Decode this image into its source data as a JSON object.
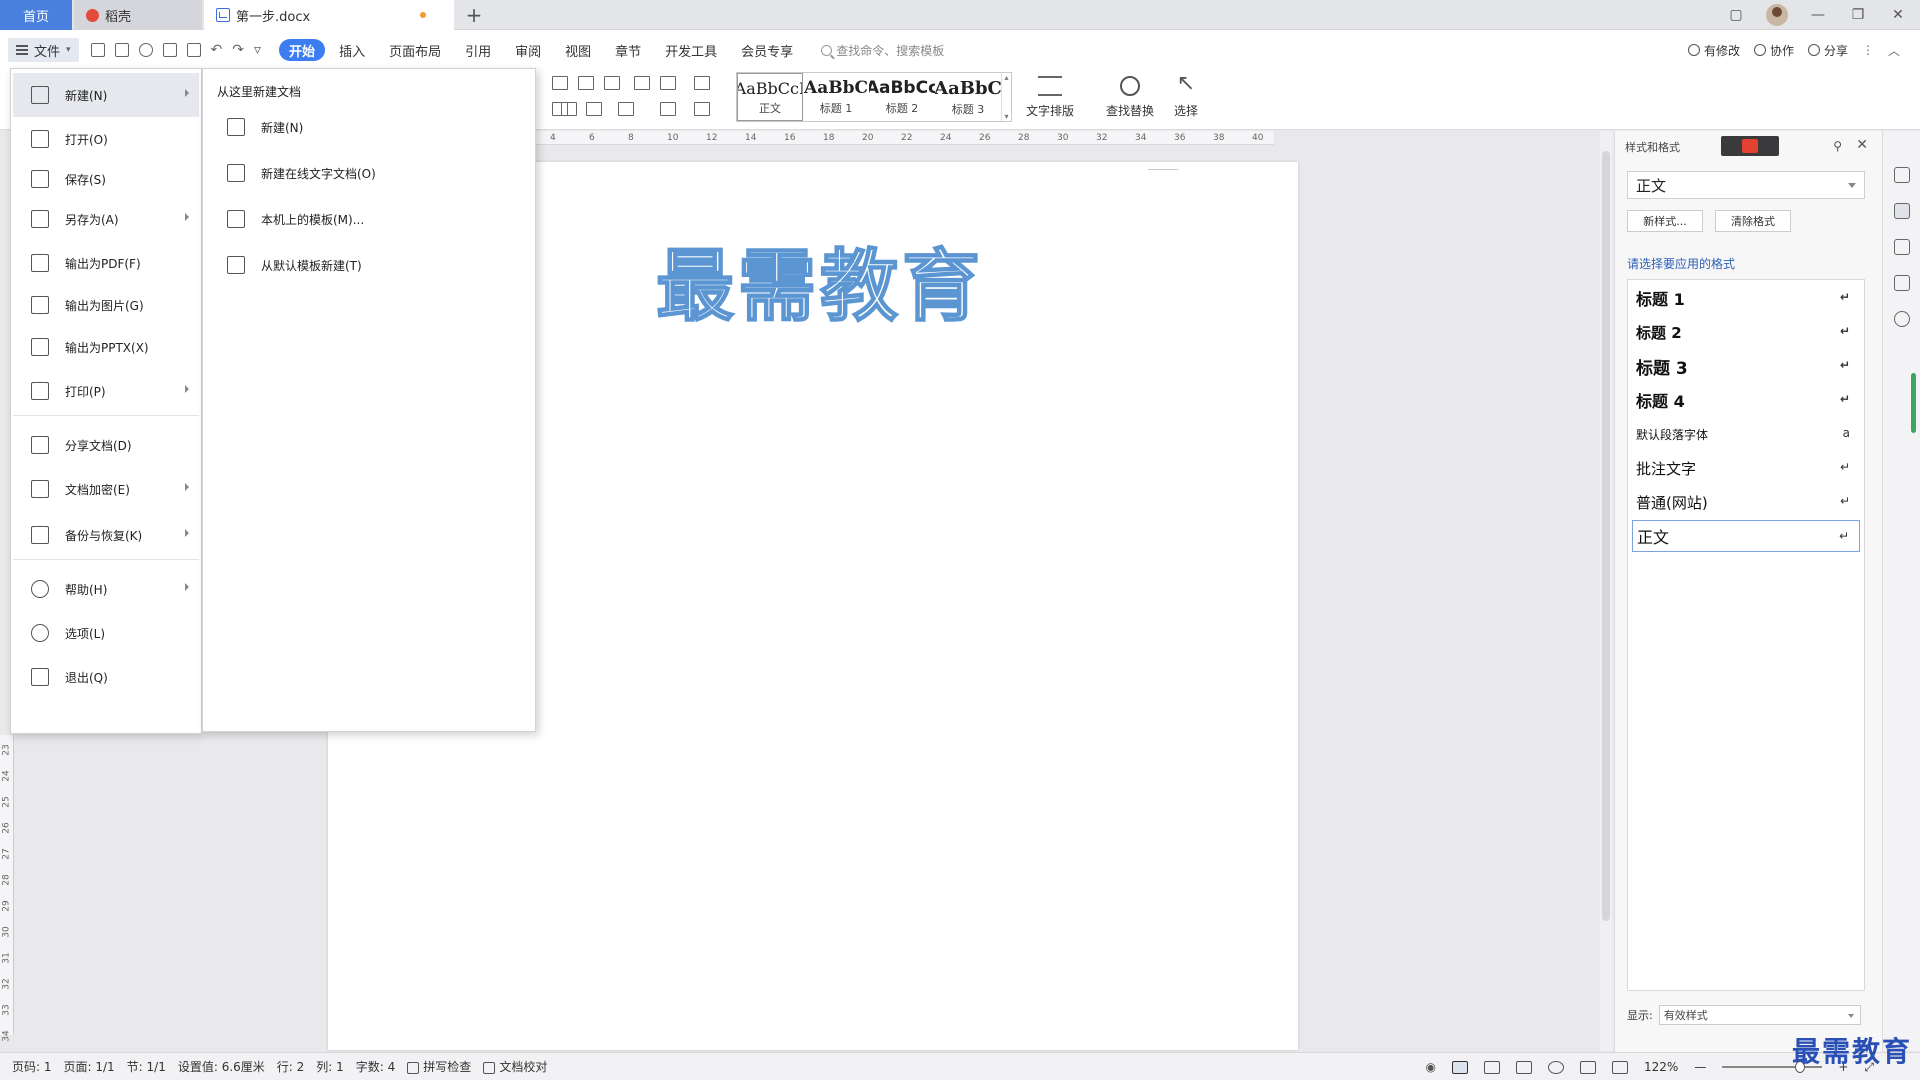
{
  "tabs": {
    "home": "首页",
    "daoke": "稻壳",
    "document": "第一步.docx",
    "new_tab": "+"
  },
  "menu": {
    "file": "文件",
    "tabs": [
      "开始",
      "插入",
      "页面布局",
      "引用",
      "审阅",
      "视图",
      "章节",
      "开发工具",
      "会员专享"
    ],
    "active_tab": "开始",
    "search_placeholder": "查找命令、搜索模板",
    "right": [
      "有修改",
      "协作",
      "分享"
    ]
  },
  "ribbon": {
    "styles": [
      {
        "sample": "AaBbCcI",
        "label": "正文"
      },
      {
        "sample": "AaBbC",
        "label": "标题 1"
      },
      {
        "sample": "AaBbCc",
        "label": "标题 2"
      },
      {
        "sample": "AaBbC",
        "label": "标题 3"
      }
    ],
    "text_layout": "文字排版",
    "find_replace": "查找替换",
    "select": "选择"
  },
  "ruler": {
    "h_ticks": [
      "4",
      "6",
      "8",
      "10",
      "12",
      "14",
      "16",
      "18",
      "20",
      "22",
      "24",
      "26",
      "28",
      "30",
      "32",
      "34",
      "36",
      "38",
      "40"
    ],
    "v_ticks": [
      "23",
      "24",
      "25",
      "26",
      "27",
      "28",
      "29",
      "30",
      "31",
      "32",
      "33",
      "34"
    ]
  },
  "document": {
    "text": "最需教育"
  },
  "file_menu": {
    "items": [
      {
        "label": "新建(N)",
        "arrow": true,
        "hover": true
      },
      {
        "label": "打开(O)",
        "arrow": false
      },
      {
        "label": "保存(S)",
        "arrow": false
      },
      {
        "label": "另存为(A)",
        "arrow": true
      },
      {
        "label": "输出为PDF(F)",
        "arrow": false
      },
      {
        "label": "输出为图片(G)",
        "arrow": false
      },
      {
        "label": "输出为PPTX(X)",
        "arrow": false
      },
      {
        "label": "打印(P)",
        "arrow": true
      },
      {
        "label": "分享文档(D)",
        "arrow": false
      },
      {
        "label": "文档加密(E)",
        "arrow": true
      },
      {
        "label": "备份与恢复(K)",
        "arrow": true
      },
      {
        "label": "帮助(H)",
        "arrow": true
      },
      {
        "label": "选项(L)",
        "arrow": false
      },
      {
        "label": "退出(Q)",
        "arrow": false
      }
    ]
  },
  "new_submenu": {
    "title": "从这里新建文档",
    "items": [
      "新建(N)",
      "新建在线文字文档(O)",
      "本机上的模板(M)...",
      "从默认模板新建(T)"
    ]
  },
  "style_panel": {
    "header": "样式和格式",
    "current_style": "正文",
    "new_style_btn": "新样式...",
    "clear_format_btn": "清除格式",
    "subtitle": "请选择要应用的格式",
    "items": [
      {
        "label": "标题  1",
        "mark": "↵"
      },
      {
        "label": "标题  2",
        "mark": "↵"
      },
      {
        "label": "标题  3",
        "mark": "↵"
      },
      {
        "label": "标题  4",
        "mark": "↵"
      },
      {
        "label": "默认段落字体",
        "mark": "a"
      },
      {
        "label": "批注文字",
        "mark": "↵"
      },
      {
        "label": "普通(网站)",
        "mark": "↵"
      },
      {
        "label": "正文",
        "mark": "↵"
      }
    ],
    "show_label": "显示:",
    "show_value": "有效样式"
  },
  "status": {
    "page_no": "页码: 1",
    "pages": "页面: 1/1",
    "section": "节: 1/1",
    "setting": "设置值: 6.6厘米",
    "row": "行: 2",
    "col": "列: 1",
    "words": "字数: 4",
    "spell": "拼写检查",
    "proof": "文档校对",
    "zoom": "122%",
    "zoom_level": 0.78
  },
  "watermark": "最需教育",
  "colors": {
    "accent": "#3c7ef2",
    "home_tab": "#4a80dd",
    "doc_outline": "#5b96d2",
    "watermark": "#2a4fb5"
  }
}
